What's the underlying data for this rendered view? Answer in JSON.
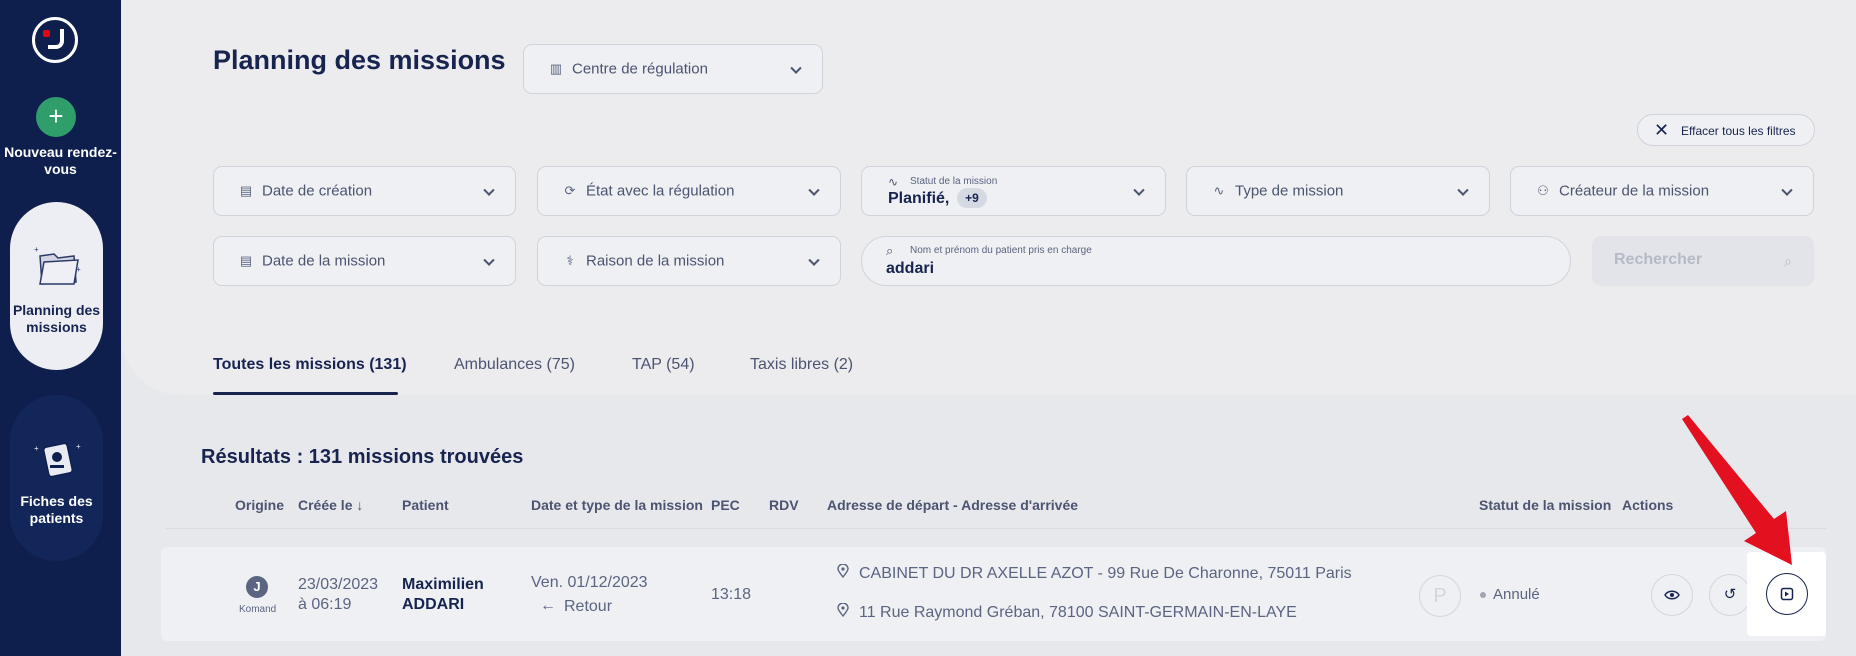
{
  "sidebar": {
    "new_appointment_label": "Nouveau rendez-vous",
    "items": [
      {
        "label": "Planning des missions",
        "active": true
      },
      {
        "label": "Fiches des patients",
        "active": false
      }
    ]
  },
  "header": {
    "title": "Planning des missions",
    "center_select": "Centre de régulation",
    "clear_filters": "Effacer tous les filtres"
  },
  "filters": {
    "creation_date": "Date de création",
    "regulation_state": "État avec la régulation",
    "mission_status_caption": "Statut de la mission",
    "mission_status_value": "Planifié,",
    "mission_status_more": "+9",
    "mission_type": "Type de mission",
    "mission_creator": "Créateur de la mission",
    "mission_date": "Date de la mission",
    "mission_reason": "Raison de la mission",
    "patient_search_caption": "Nom et prénom du patient pris en charge",
    "patient_search_value": "addari",
    "search_button": "Rechercher"
  },
  "tabs": [
    {
      "label": "Toutes les missions (131)",
      "active": true
    },
    {
      "label": "Ambulances (75)"
    },
    {
      "label": "TAP (54)"
    },
    {
      "label": "Taxis libres (2)"
    }
  ],
  "results_title": "Résultats : 131 missions trouvées",
  "table": {
    "headers": [
      "Origine",
      "Créée le ↓",
      "Patient",
      "Date et type de la mission",
      "PEC",
      "RDV",
      "Adresse de départ - Adresse d'arrivée",
      "Statut de la mission",
      "Actions"
    ],
    "rows": [
      {
        "origin": "Komand",
        "created_date": "23/03/2023",
        "created_time": "à 06:19",
        "patient_first": "Maximilien",
        "patient_last": "ADDARI",
        "mission_date": "Ven. 01/12/2023",
        "mission_type": "Retour",
        "pec": "13:18",
        "rdv": "",
        "address_from": "CABINET DU DR AXELLE AZOT - 99 Rue De Charonne, 75011 Paris",
        "address_to": "11 Rue Raymond Gréban, 78100 SAINT-GERMAIN-EN-LAYE",
        "p_badge": "P",
        "status": "Annulé"
      }
    ]
  },
  "icons": [
    "plus-icon",
    "building-icon",
    "calendar-icon",
    "sync-icon",
    "pulse-icon",
    "user-icon",
    "stethoscope-icon",
    "search-icon",
    "close-icon",
    "location-pin-icon",
    "arrow-left-icon",
    "eye-icon",
    "undo-icon",
    "duplicate-icon"
  ],
  "colors": {
    "sidebar": "#0e1f4d",
    "accent_green": "#2f9e6b",
    "arrow_red": "#e3101f",
    "primary_text": "#17244f"
  }
}
